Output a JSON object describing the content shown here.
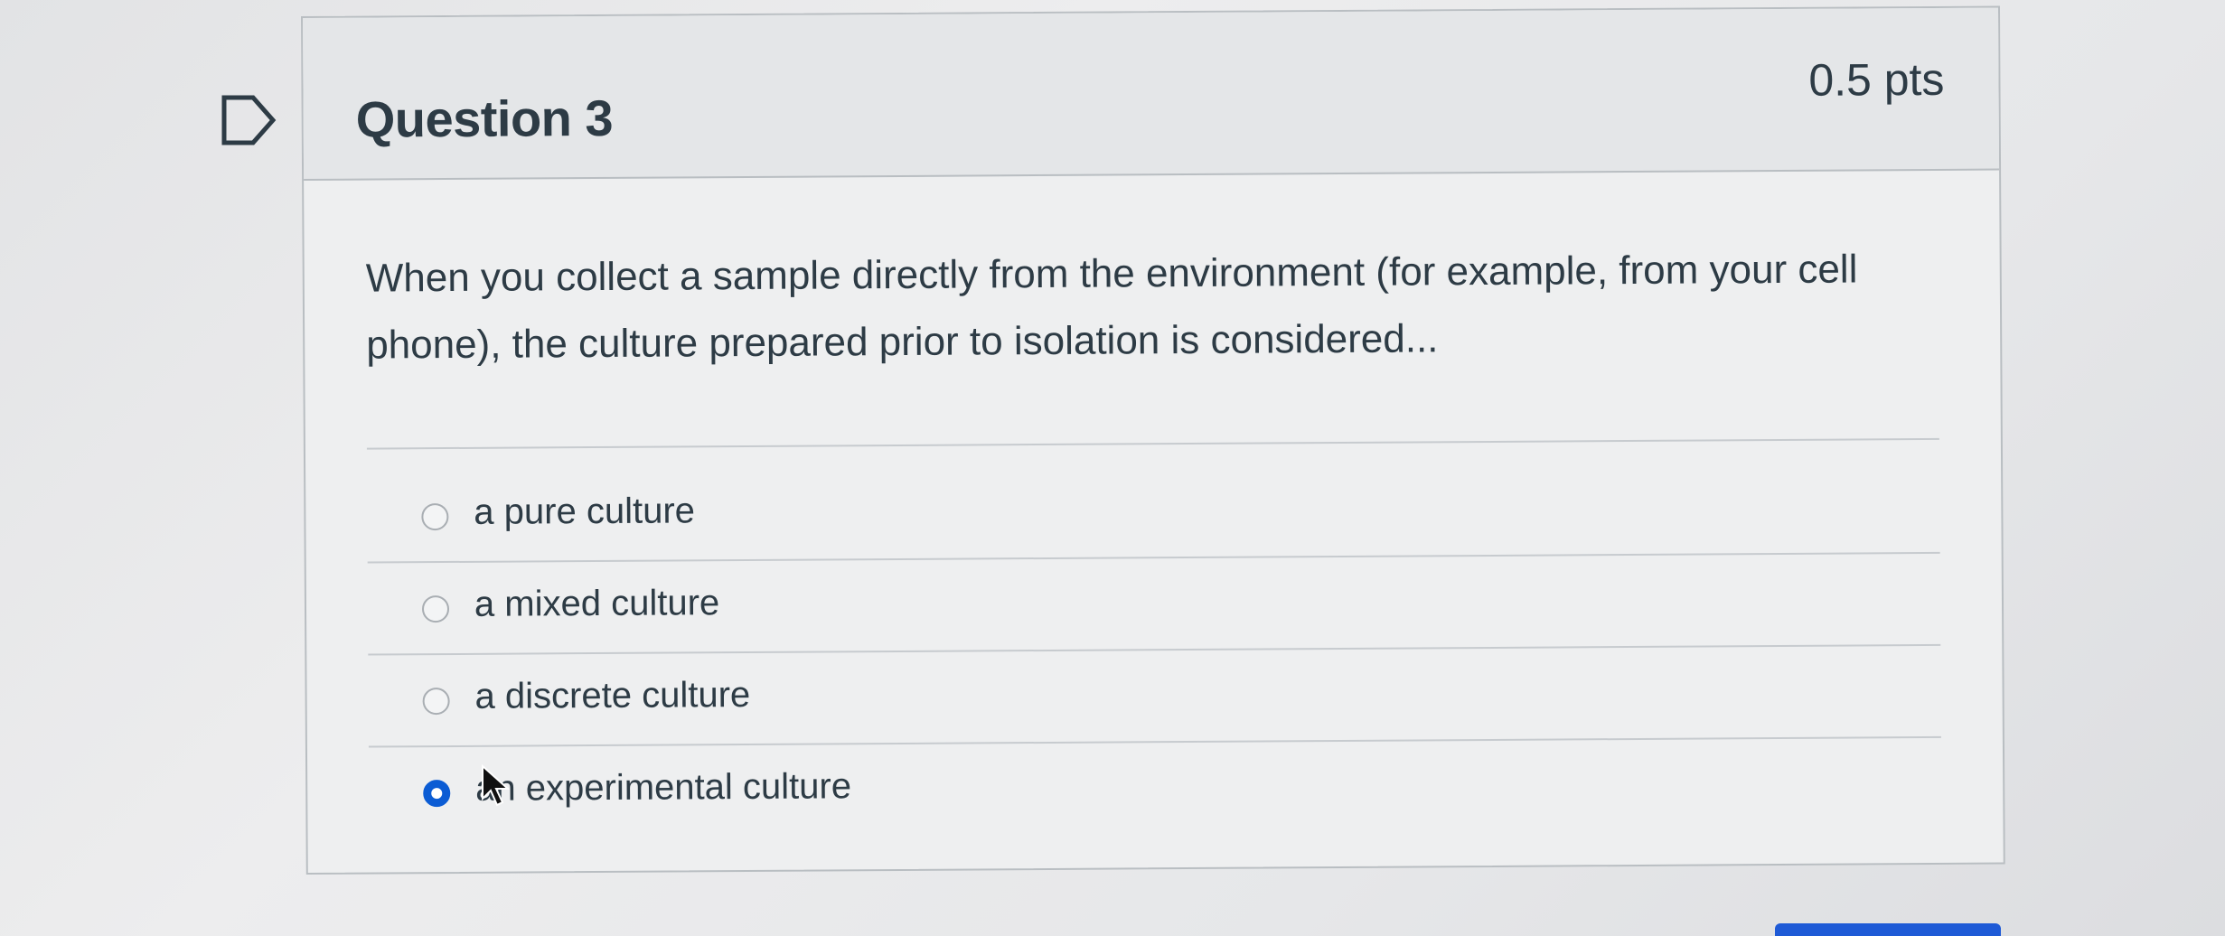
{
  "question": {
    "title": "Question 3",
    "points": "0.5 pts",
    "text": "When you collect a sample directly from the environment (for example, from your cell phone), the culture prepared prior to isolation is considered..."
  },
  "answers": [
    {
      "label": "a pure culture",
      "selected": false
    },
    {
      "label": "a mixed culture",
      "selected": false
    },
    {
      "label": "a discrete culture",
      "selected": false
    },
    {
      "label": "an experimental culture",
      "selected": true
    }
  ],
  "colors": {
    "selected_radio": "#0b5cd4",
    "text": "#2d3b45",
    "border": "#b9bec2"
  },
  "icons": [
    "flag-question-icon",
    "mouse-cursor-icon"
  ]
}
